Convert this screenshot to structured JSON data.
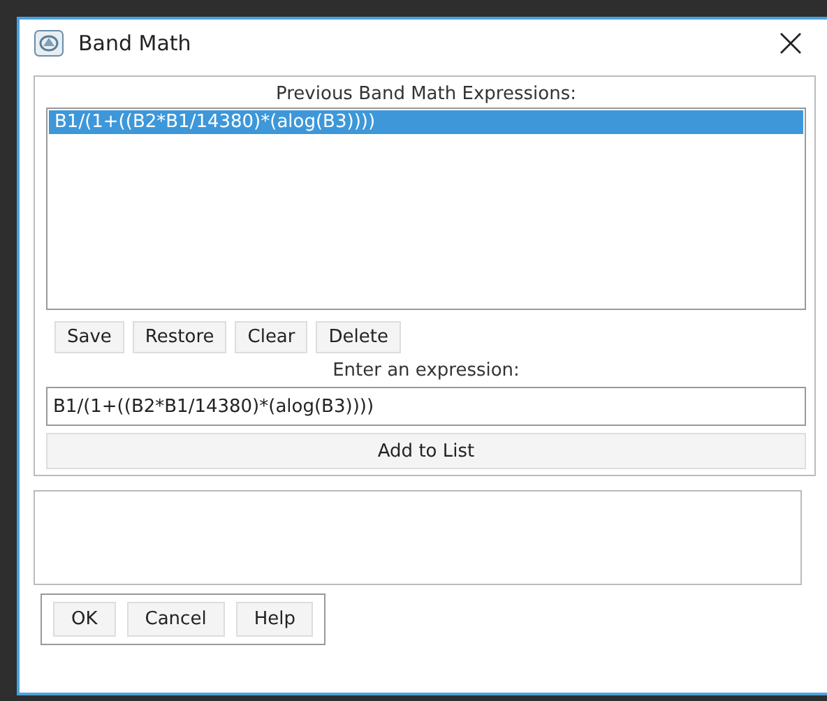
{
  "window": {
    "title": "Band Math"
  },
  "history": {
    "label": "Previous Band Math Expressions:",
    "items": [
      {
        "text": "B1/(1+((B2*B1/14380)*(alog(B3))))",
        "selected": true
      }
    ]
  },
  "history_buttons": [
    "Save",
    "Restore",
    "Clear",
    "Delete"
  ],
  "expression": {
    "label": "Enter an expression:",
    "value": "B1/(1+((B2*B1/14380)*(alog(B3))))"
  },
  "add_button": "Add to List",
  "dialog_buttons": [
    "OK",
    "Cancel",
    "Help"
  ]
}
